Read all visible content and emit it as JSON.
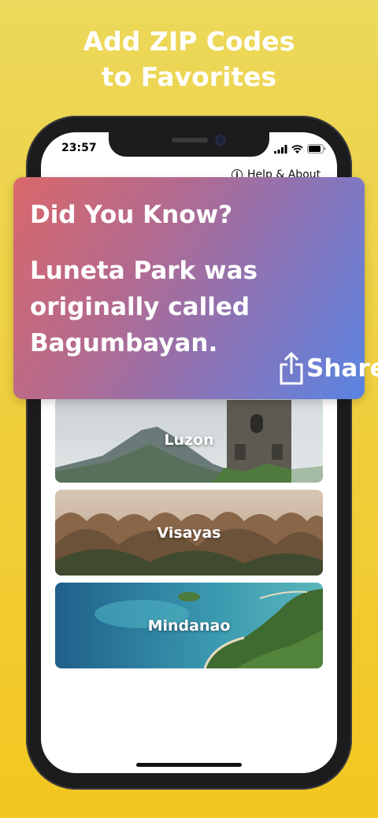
{
  "headline": {
    "line1": "Add ZIP Codes",
    "line2": "to Favorites"
  },
  "status_bar": {
    "time": "23:57",
    "icons": [
      "cellular-signal-icon",
      "wifi-icon",
      "battery-icon"
    ]
  },
  "help": {
    "label": "Help & About",
    "icon": "info-icon"
  },
  "fact_card": {
    "title": "Did You Know?",
    "body": "Luneta Park was originally called Bagumbayan.",
    "share_label": "Share",
    "share_icon": "share-icon"
  },
  "regions": [
    {
      "name": "Luzon"
    },
    {
      "name": "Visayas"
    },
    {
      "name": "Mindanao"
    }
  ],
  "colors": {
    "background_top": "#ecd85a",
    "background_bottom": "#f3c620",
    "card_gradient_start": "#d9686a",
    "card_gradient_end": "#5a84e2"
  }
}
